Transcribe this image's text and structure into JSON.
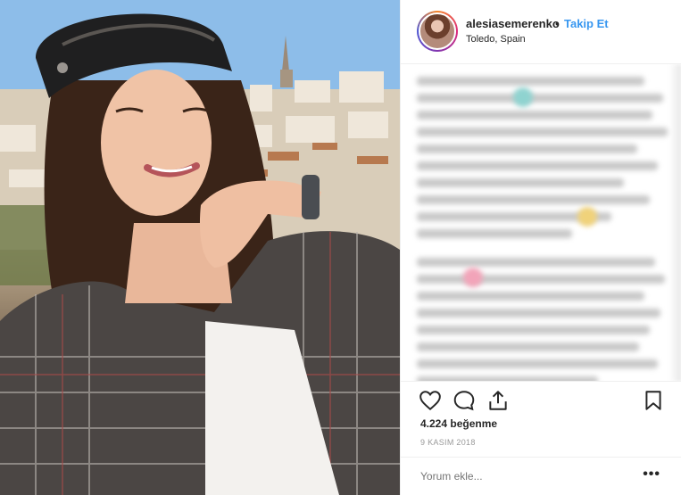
{
  "post": {
    "username": "alesiasemerenko",
    "separator": "•",
    "follow_label": "Takip Et",
    "location": "Toledo, Spain",
    "likes_text": "4.224 beğenme",
    "date_text": "9 KASIM 2018",
    "comment_placeholder": "Yorum ekle...",
    "more_label": "•••"
  },
  "icons": {
    "like": "heart-icon",
    "comment": "speech-bubble-icon",
    "share": "share-icon",
    "save": "bookmark-icon"
  },
  "colors": {
    "follow_blue": "#3897f0",
    "text": "#262626",
    "muted": "#999999",
    "divider": "#efefef"
  }
}
